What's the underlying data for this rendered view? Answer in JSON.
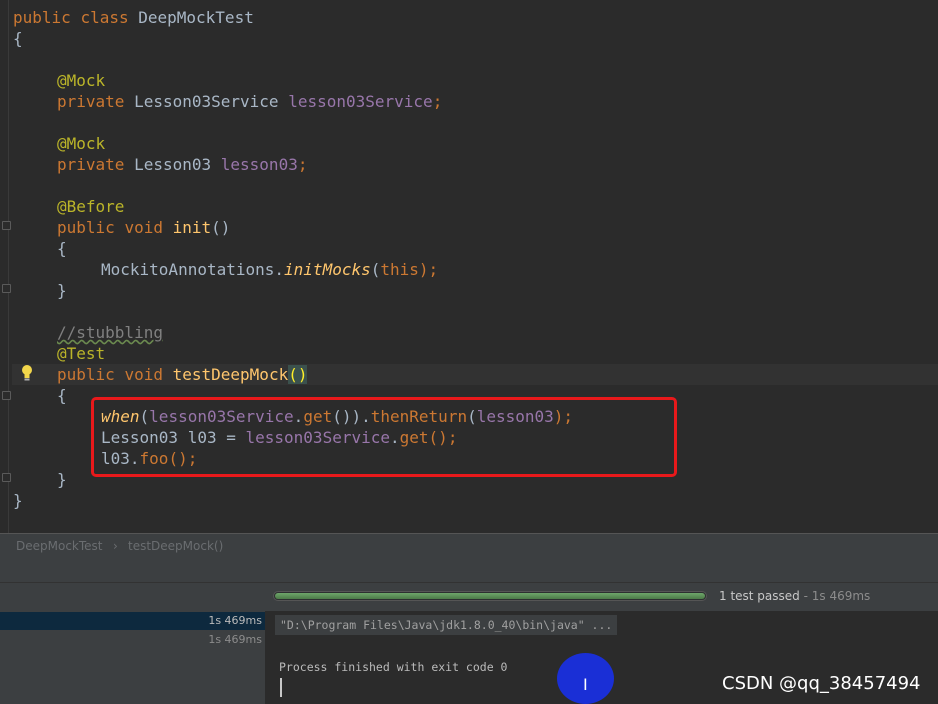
{
  "editor": {
    "lines": [
      [
        "public ",
        "class ",
        "DeepMockTest"
      ],
      [
        "{"
      ],
      [],
      [
        "@Mock"
      ],
      [
        "private ",
        "Lesson03Service ",
        "lesson03Service",
        ";"
      ],
      [],
      [
        "@Mock"
      ],
      [
        "private ",
        "Lesson03 ",
        "lesson03",
        ";"
      ],
      [],
      [
        "@Before"
      ],
      [
        "public ",
        "void ",
        "init",
        "()"
      ],
      [
        "{"
      ],
      [
        "MockitoAnnotations.",
        "initMocks",
        "(",
        "this",
        ");"
      ],
      [
        "}"
      ],
      [],
      [
        "//stubbling"
      ],
      [
        "@Test"
      ],
      [
        "public ",
        "void ",
        "testDeepMock",
        "()"
      ],
      [
        "{"
      ],
      [
        "when",
        "(",
        "lesson03Service",
        ".",
        "get",
        "()).",
        "thenReturn",
        "(",
        "lesson03",
        ");"
      ],
      [
        "Lesson03 l03 = ",
        "lesson03Service",
        ".",
        "get",
        "();"
      ],
      [
        "l03.",
        "foo",
        "();"
      ],
      [
        "}"
      ],
      [
        "}"
      ]
    ]
  },
  "breadcrumb": {
    "class_name": "DeepMockTest",
    "separator": "›",
    "method_name": "testDeepMock()"
  },
  "run": {
    "progress": 1.0,
    "status_text": "1 test passed",
    "status_sep": " - ",
    "status_time": "1s 469ms"
  },
  "tree": {
    "rows": [
      "1s 469ms",
      "1s 469ms"
    ]
  },
  "console": {
    "command": "\"D:\\Program Files\\Java\\jdk1.8.0_40\\bin\\java\" ...",
    "finish": "Process finished with exit code 0"
  },
  "watermark": "CSDN @qq_38457494",
  "colors": {
    "background": "#2b2b2b",
    "keyword": "#cc7832",
    "annotation": "#bbb529",
    "field": "#9876aa",
    "method": "#ffc66d",
    "highlight_box": "#e8191b",
    "progress": "#5a9455"
  },
  "icons": [
    "lightbulb-icon",
    "fold-marker-icon",
    "text-cursor-icon"
  ]
}
